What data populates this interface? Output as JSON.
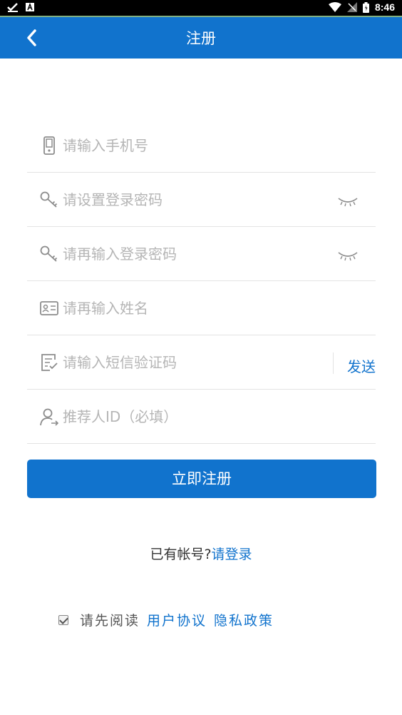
{
  "status_bar": {
    "time": "8:46",
    "left_icons": [
      "check-icon",
      "a-icon"
    ],
    "right_icons": [
      "wifi-icon",
      "no-signal-icon",
      "battery-icon"
    ]
  },
  "header": {
    "title": "注册",
    "back_icon": "chevron-left-icon",
    "bg_color": "#1173cd"
  },
  "form": {
    "phone": {
      "placeholder": "请输入手机号",
      "value": "",
      "icon": "phone-icon"
    },
    "password": {
      "placeholder": "请设置登录密码",
      "value": "",
      "icon": "key-icon",
      "toggle_icon": "eye-closed-icon"
    },
    "password_confirm": {
      "placeholder": "请再输入登录密码",
      "value": "",
      "icon": "key-icon",
      "toggle_icon": "eye-closed-icon"
    },
    "name": {
      "placeholder": "请再输入姓名",
      "value": "",
      "icon": "id-card-icon"
    },
    "sms_code": {
      "placeholder": "请输入短信验证码",
      "value": "",
      "icon": "checklist-icon",
      "send_label": "发送"
    },
    "referrer": {
      "placeholder": "推荐人ID（必填）",
      "value": "",
      "icon": "user-arrow-icon"
    }
  },
  "submit_label": "立即注册",
  "login": {
    "question": "已有帐号?",
    "link": "请登录"
  },
  "agreement": {
    "checked": true,
    "prefix": "请先阅读",
    "user_agreement": "用户协议",
    "privacy_policy": "隐私政策"
  },
  "accent_color": "#1173cd"
}
